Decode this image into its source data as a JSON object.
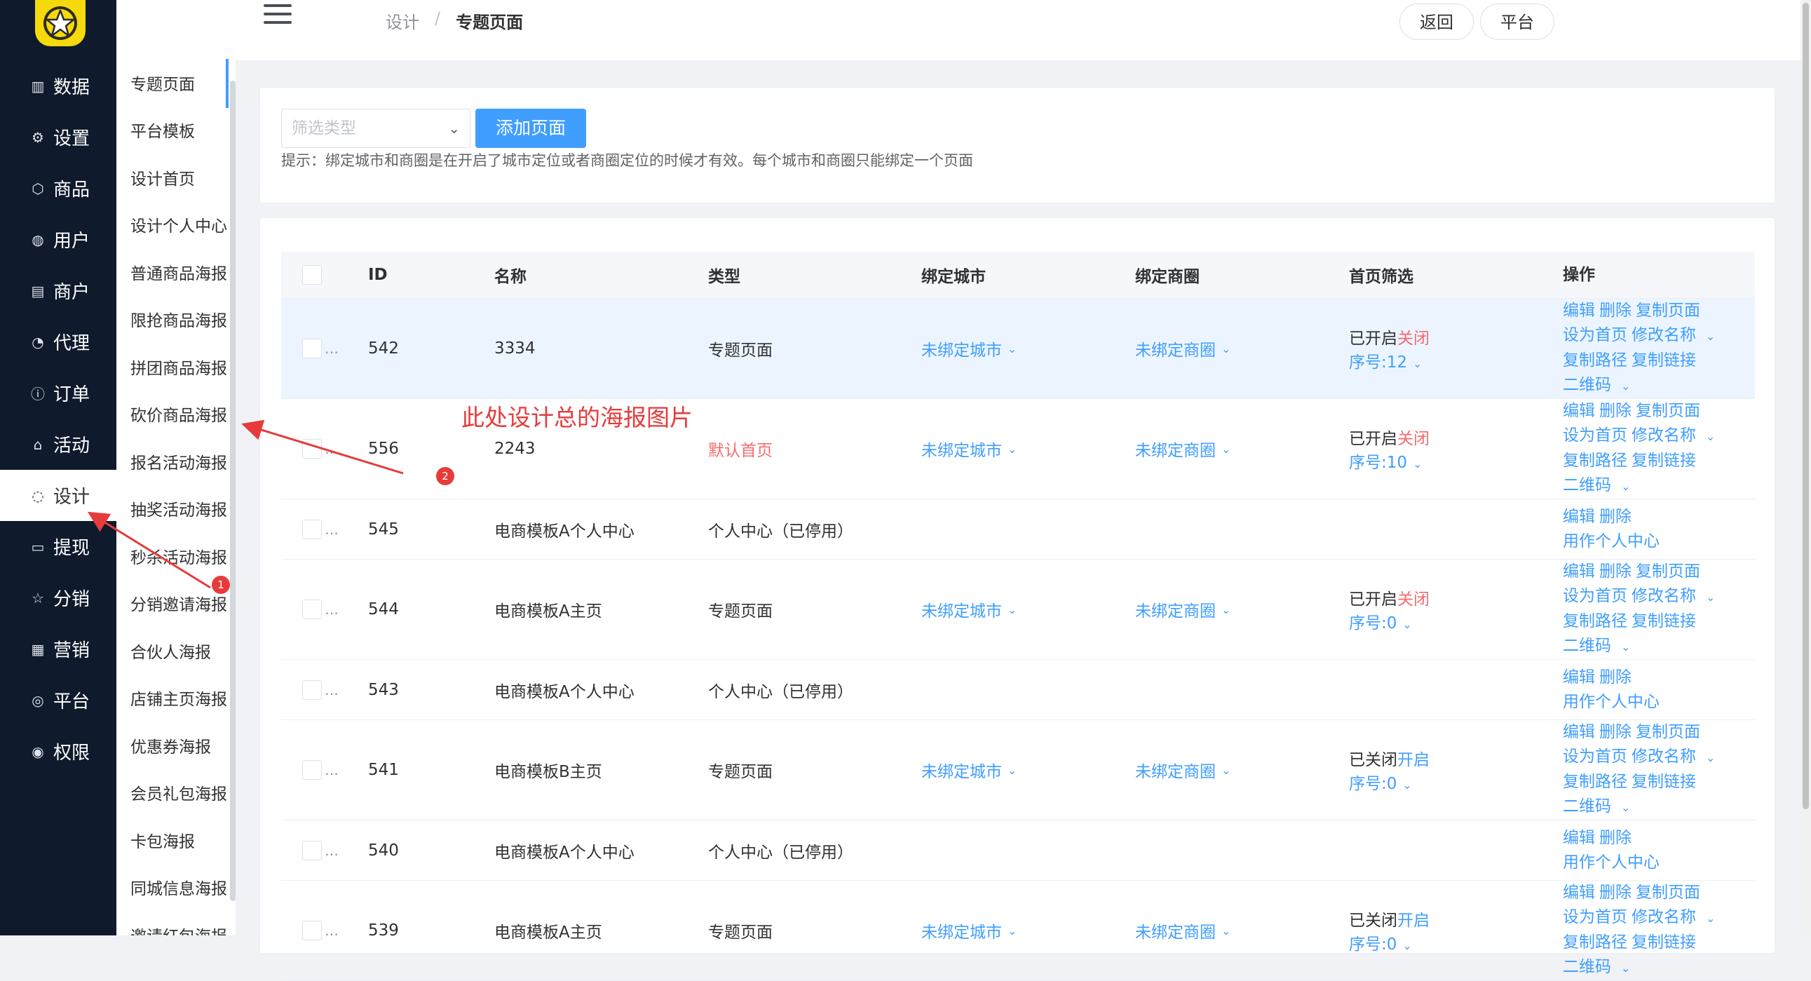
{
  "nav": {
    "items": [
      {
        "label": "数据",
        "icon": "bar-chart-icon"
      },
      {
        "label": "设置",
        "icon": "gear-icon"
      },
      {
        "label": "商品",
        "icon": "box-icon"
      },
      {
        "label": "用户",
        "icon": "user-icon"
      },
      {
        "label": "商户",
        "icon": "store-icon"
      },
      {
        "label": "代理",
        "icon": "pie-icon"
      },
      {
        "label": "订单",
        "icon": "info-icon"
      },
      {
        "label": "活动",
        "icon": "tag-icon"
      },
      {
        "label": "设计",
        "icon": "palette-icon"
      },
      {
        "label": "提现",
        "icon": "wallet-icon"
      },
      {
        "label": "分销",
        "icon": "star-icon"
      },
      {
        "label": "营销",
        "icon": "grid-icon"
      },
      {
        "label": "平台",
        "icon": "globe-icon"
      },
      {
        "label": "权限",
        "icon": "compass-icon"
      }
    ],
    "active_index": 8
  },
  "submenu": {
    "items": [
      "专题页面",
      "平台模板",
      "设计首页",
      "设计个人中心",
      "普通商品海报",
      "限抢商品海报",
      "拼团商品海报",
      "砍价商品海报",
      "报名活动海报",
      "抽奖活动海报",
      "秒杀活动海报",
      "分销邀请海报",
      "合伙人海报",
      "店铺主页海报",
      "优惠券海报",
      "会员礼包海报",
      "卡包海报",
      "同城信息海报",
      "邀请红包海报"
    ]
  },
  "header": {
    "breadcrumb_1": "设计",
    "breadcrumb_sep": "/",
    "breadcrumb_2": "专题页面",
    "back_label": "返回",
    "platform_label": "平台"
  },
  "filter": {
    "select_placeholder": "筛选类型",
    "add_label": "添加页面",
    "hint": "提示：绑定城市和商圈是在开启了城市定位或者商圈定位的时候才有效。每个城市和商圈只能绑定一个页面"
  },
  "table": {
    "headers": {
      "id": "ID",
      "name": "名称",
      "type": "类型",
      "city": "绑定城市",
      "circle": "绑定商圈",
      "filter": "首页筛选",
      "ops": "操作"
    },
    "rows": [
      {
        "id": "542",
        "name": "3334",
        "type": "专题页面",
        "type_red": false,
        "city": "未绑定城市",
        "circle": "未绑定商圈",
        "status": "已开启",
        "toggle": "关闭",
        "toggle_red": true,
        "seq": "序号:12",
        "ops": "full"
      },
      {
        "id": "556",
        "name": "2243",
        "type": "默认首页",
        "type_red": true,
        "city": "未绑定城市",
        "circle": "未绑定商圈",
        "status": "已开启",
        "toggle": "关闭",
        "toggle_red": true,
        "seq": "序号:10",
        "ops": "full"
      },
      {
        "id": "545",
        "name": "电商模板A个人中心",
        "type": "个人中心（已停用）",
        "type_red": false,
        "city": "",
        "circle": "",
        "status": "",
        "toggle": "",
        "toggle_red": false,
        "seq": "",
        "ops": "short"
      },
      {
        "id": "544",
        "name": "电商模板A主页",
        "type": "专题页面",
        "type_red": false,
        "city": "未绑定城市",
        "circle": "未绑定商圈",
        "status": "已开启",
        "toggle": "关闭",
        "toggle_red": true,
        "seq": "序号:0",
        "ops": "full"
      },
      {
        "id": "543",
        "name": "电商模板A个人中心",
        "type": "个人中心（已停用）",
        "type_red": false,
        "city": "",
        "circle": "",
        "status": "",
        "toggle": "",
        "toggle_red": false,
        "seq": "",
        "ops": "short"
      },
      {
        "id": "541",
        "name": "电商模板B主页",
        "type": "专题页面",
        "type_red": false,
        "city": "未绑定城市",
        "circle": "未绑定商圈",
        "status": "已关闭",
        "toggle": "开启",
        "toggle_red": false,
        "seq": "序号:0",
        "ops": "full"
      },
      {
        "id": "540",
        "name": "电商模板A个人中心",
        "type": "个人中心（已停用）",
        "type_red": false,
        "city": "",
        "circle": "",
        "status": "",
        "toggle": "",
        "toggle_red": false,
        "seq": "",
        "ops": "short"
      },
      {
        "id": "539",
        "name": "电商模板A主页",
        "type": "专题页面",
        "type_red": false,
        "city": "未绑定城市",
        "circle": "未绑定商圈",
        "status": "已关闭",
        "toggle": "开启",
        "toggle_red": false,
        "seq": "序号:0",
        "ops": "full"
      }
    ],
    "ops_full": [
      "编辑",
      "删除",
      "复制页面",
      "设为首页",
      "修改名称",
      "复制路径",
      "复制链接",
      "二维码"
    ],
    "ops_short": [
      "编辑",
      "删除",
      "用作个人中心"
    ]
  },
  "annotation": {
    "text": "此处设计总的海报图片",
    "badge_1": "1",
    "badge_2": "2"
  },
  "colors": {
    "nav_bg": "#0f1a2c",
    "primary": "#409eff",
    "danger": "#f56c6c",
    "annotation": "#e63b3b"
  }
}
